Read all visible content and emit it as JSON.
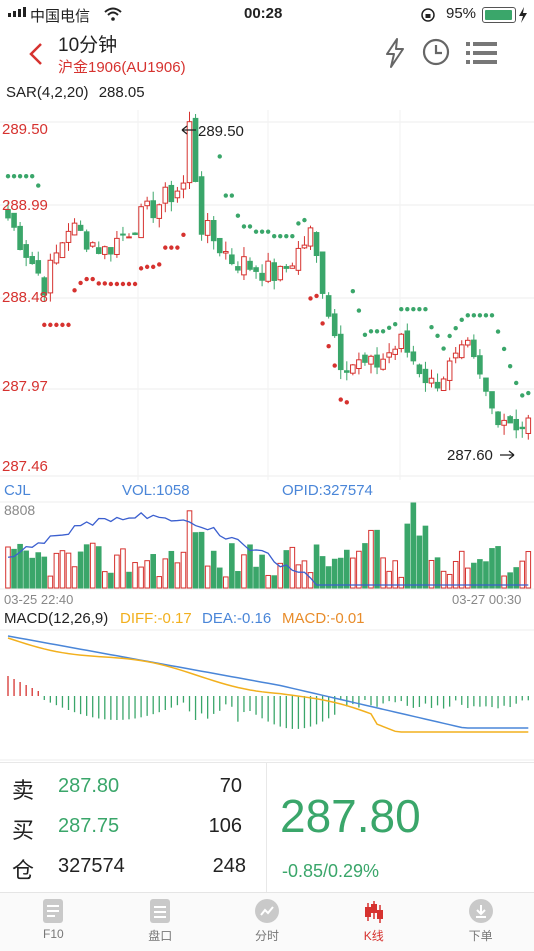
{
  "status_bar": {
    "carrier": "中国电信",
    "time": "00:28",
    "battery": "95%"
  },
  "header": {
    "title": "10分钟",
    "subtitle": "沪金1906(AU1906)"
  },
  "main_chart": {
    "indicator_label": "SAR(4,2,20)",
    "indicator_value": "288.05",
    "y_labels": [
      "289.50",
      "288.99",
      "288.48",
      "287.97",
      "287.46"
    ],
    "high_note": "289.50",
    "low_note": "287.60"
  },
  "volume_chart": {
    "title": "CJL",
    "vol_label": "VOL:1058",
    "opid_label": "OPID:327574",
    "max_label": "8808",
    "start_time": "03-25 22:40",
    "end_time": "03-27 00:30"
  },
  "macd_chart": {
    "title": "MACD(12,26,9)",
    "diff_label": "DIFF:-0.17",
    "dea_label": "DEA:-0.16",
    "macd_label": "MACD:-0.01"
  },
  "quote": {
    "sell": {
      "label": "卖",
      "price": "287.80",
      "qty": "70"
    },
    "buy": {
      "label": "买",
      "price": "287.75",
      "qty": "106"
    },
    "open_interest": {
      "label": "仓",
      "value": "327574",
      "qty": "248"
    },
    "last_price": "287.80",
    "change": "-0.85/0.29%"
  },
  "tabs": [
    {
      "label": "F10"
    },
    {
      "label": "盘口"
    },
    {
      "label": "分时"
    },
    {
      "label": "K线"
    },
    {
      "label": "下单"
    }
  ],
  "colors": {
    "up": "#d6322f",
    "down": "#3aa66a",
    "sar_down": "#3aa66a",
    "sar_up": "#d6322f",
    "diff": "#f2b01e",
    "dea": "#4a86d8",
    "macd": "#e88c2a"
  }
}
